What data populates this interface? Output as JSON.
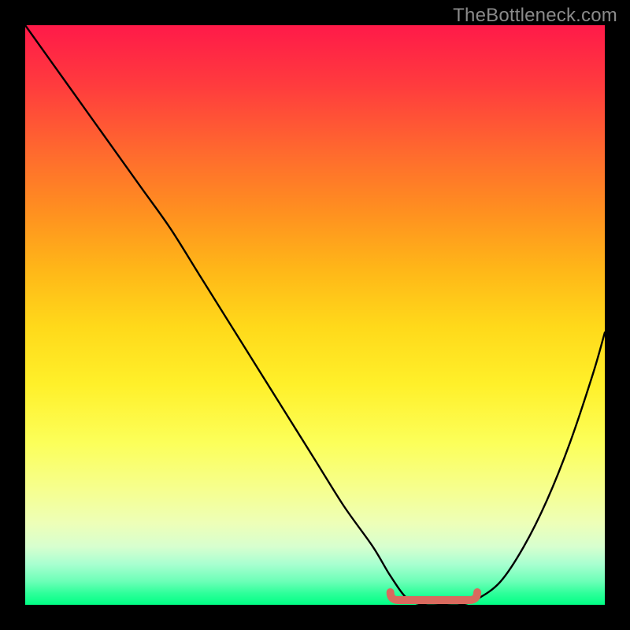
{
  "watermark": "TheBottleneck.com",
  "colors": {
    "frame": "#000000",
    "curve": "#000000",
    "valley_marker": "#d96a5e",
    "gradient_top": "#ff1a49",
    "gradient_bottom": "#00ff85"
  },
  "chart_data": {
    "type": "line",
    "title": "",
    "xlabel": "",
    "ylabel": "",
    "xlim": [
      0,
      100
    ],
    "ylim": [
      0,
      100
    ],
    "grid": false,
    "legend": false,
    "series": [
      {
        "name": "bottleneck-curve",
        "x": [
          0,
          5,
          10,
          15,
          20,
          25,
          30,
          35,
          40,
          45,
          50,
          55,
          60,
          63,
          66,
          69,
          72,
          75,
          78,
          82,
          86,
          90,
          94,
          98,
          100
        ],
        "values": [
          100,
          93,
          86,
          79,
          72,
          65,
          57,
          49,
          41,
          33,
          25,
          17,
          10,
          5,
          1,
          0,
          0,
          0,
          1,
          4,
          10,
          18,
          28,
          40,
          47
        ]
      }
    ],
    "annotations": [
      {
        "name": "valley-marker",
        "shape": "rounded-segment",
        "x_range": [
          63,
          78
        ],
        "y": 0,
        "color": "#d96a5e"
      }
    ]
  }
}
